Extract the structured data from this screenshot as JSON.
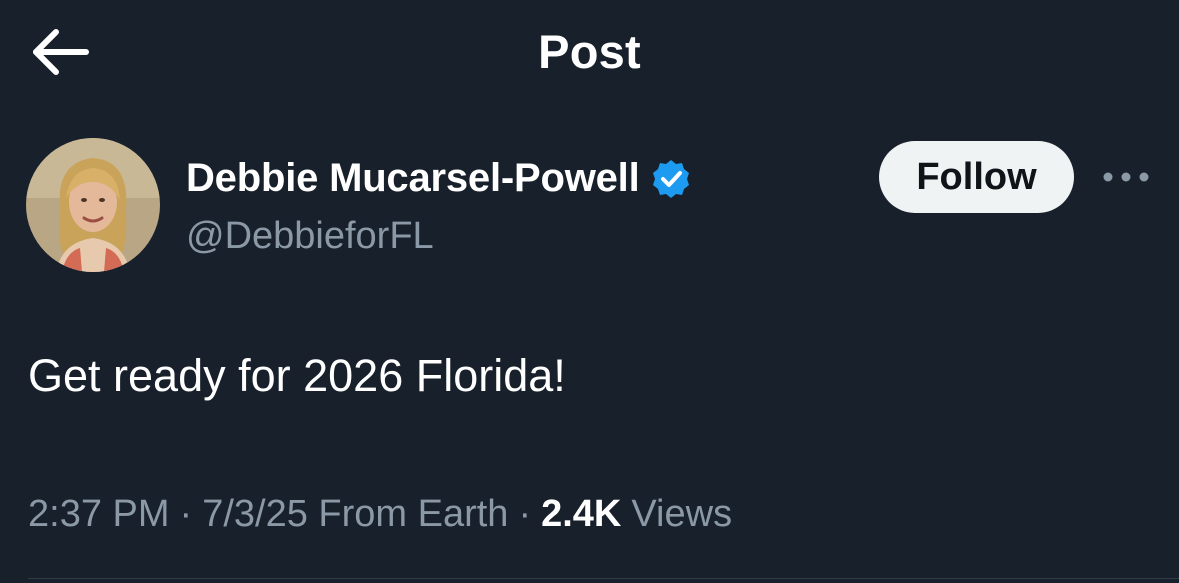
{
  "header": {
    "back_icon": "arrow-left-icon",
    "title": "Post"
  },
  "author": {
    "avatar_icon": "profile-photo",
    "name": "Debbie Mucarsel-Powell",
    "verified_icon": "verified-badge-icon",
    "verified_color": "#1d9bf0",
    "handle": "@DebbieforFL",
    "follow_label": "Follow",
    "more_icon": "more-horizontal-icon"
  },
  "post": {
    "text": "Get ready for 2026 Florida!"
  },
  "meta": {
    "time": "2:37 PM",
    "separator": "·",
    "date": "7/3/25",
    "source": "From Earth",
    "views_count": "2.4K",
    "views_label": "Views"
  },
  "colors": {
    "background": "#17202b",
    "primary_text": "#ffffff",
    "secondary_text": "#8b98a5",
    "follow_bg": "#eff3f4",
    "follow_text": "#0f1419",
    "accent": "#1d9bf0"
  }
}
